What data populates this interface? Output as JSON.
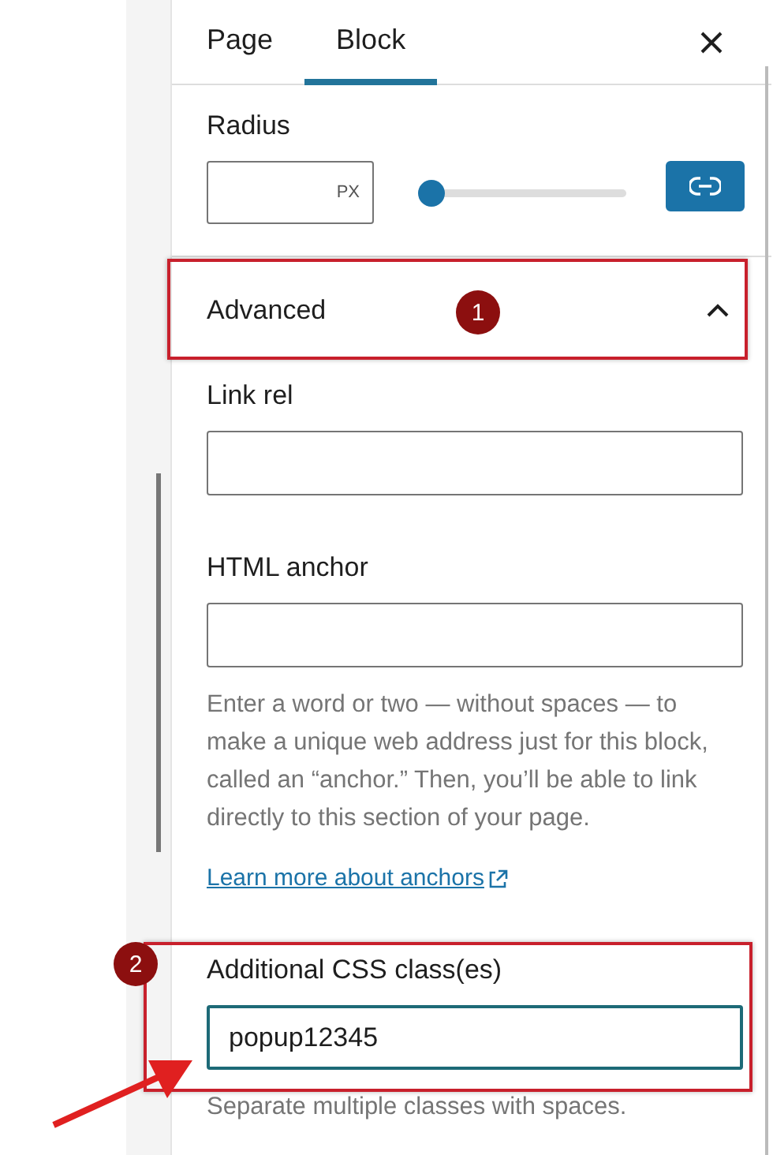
{
  "tabs": [
    {
      "label": "Page",
      "selected": false
    },
    {
      "label": "Block",
      "selected": true
    }
  ],
  "radius": {
    "label": "Radius",
    "unit": "PX",
    "level": 0,
    "linked": true
  },
  "advanced": {
    "title": "Advanced",
    "expanded": true,
    "fields": [
      {
        "label": "Link rel",
        "focused": false
      },
      {
        "label": "HTML anchor",
        "focused": false,
        "help": "Enter a word or two — without spaces — to make a unique web address just for this block, called an “anchor.” Then, you’ll be able to link directly to this section of your page.",
        "link": "Learn more about anchors"
      },
      {
        "label": "Additional CSS class(es)",
        "value": "popup12345",
        "focused": true,
        "help": "Separate multiple classes with spaces."
      }
    ]
  },
  "annotations": [
    {
      "number": "1"
    },
    {
      "number": "2"
    }
  ]
}
